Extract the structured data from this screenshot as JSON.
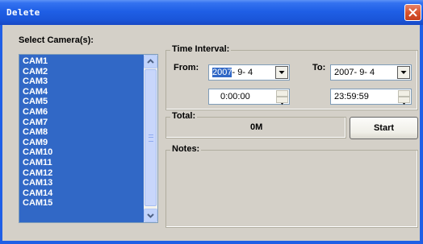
{
  "window": {
    "title": "Delete"
  },
  "cameras": {
    "label": "Select Camera(s):",
    "items": [
      "CAM1",
      "CAM2",
      "CAM3",
      "CAM4",
      "CAM5",
      "CAM6",
      "CAM7",
      "CAM8",
      "CAM9",
      "CAM10",
      "CAM11",
      "CAM12",
      "CAM13",
      "CAM14",
      "CAM15"
    ]
  },
  "time_interval": {
    "label": "Time Interval:",
    "from_label": "From:",
    "to_label": "To:",
    "from_date_year": "2007",
    "from_date_rest": "- 9- 4",
    "from_time": "0:00:00",
    "to_date": "2007- 9- 4",
    "to_time": "23:59:59"
  },
  "total": {
    "label": "Total:",
    "value": "0M"
  },
  "start_label": "Start",
  "notes": {
    "label": "Notes:"
  },
  "colors": {
    "titlebar": "#1f5fe6",
    "selection": "#3168c6",
    "face": "#d4d0c8"
  }
}
